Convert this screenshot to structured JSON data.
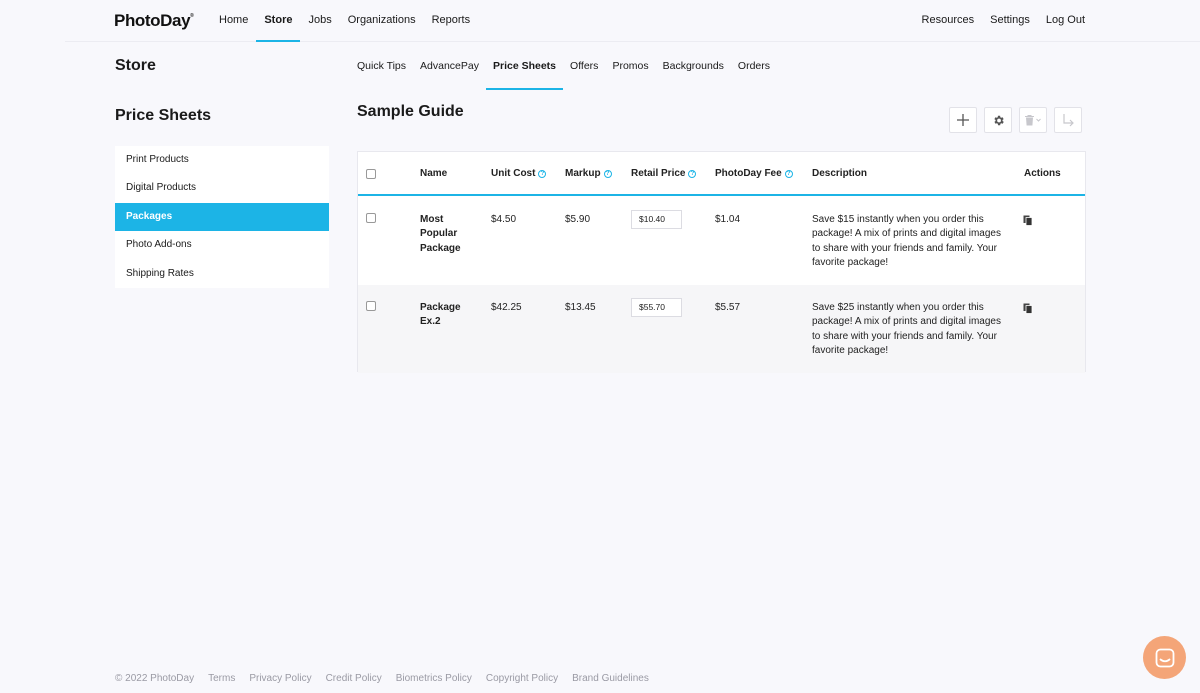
{
  "app": {
    "logo": "PhotoDay",
    "logo_mark": "®"
  },
  "topnav": {
    "left": [
      "Home",
      "Store",
      "Jobs",
      "Organizations",
      "Reports"
    ],
    "right": [
      "Resources",
      "Settings",
      "Log Out"
    ]
  },
  "store": {
    "title": "Store",
    "tabs": [
      "Quick Tips",
      "AdvancePay",
      "Price Sheets",
      "Offers",
      "Promos",
      "Backgrounds",
      "Orders"
    ]
  },
  "sidebar": {
    "title": "Price Sheets",
    "items": [
      "Print Products",
      "Digital Products",
      "Packages",
      "Photo Add-ons",
      "Shipping Rates"
    ]
  },
  "main": {
    "title": "Sample Guide",
    "help_glyph": "?",
    "columns": {
      "name": "Name",
      "unit_cost": "Unit Cost",
      "markup": "Markup",
      "retail_price": "Retail Price",
      "photoday_fee": "PhotoDay Fee",
      "description": "Description",
      "actions": "Actions"
    },
    "rows": [
      {
        "name": "Most Popular Package",
        "unit_cost": "$4.50",
        "markup": "$5.90",
        "retail_price": "$10.40",
        "photoday_fee": "$1.04",
        "description": "Save $15 instantly when you order this package! A mix of prints and digital images to share with your friends and family. Your favorite package!"
      },
      {
        "name": "Package Ex.2",
        "unit_cost": "$42.25",
        "markup": "$13.45",
        "retail_price": "$55.70",
        "photoday_fee": "$5.57",
        "description": "Save $25 instantly when you order this package! A mix of prints and digital images to share with your friends and family. Your favorite package!"
      }
    ]
  },
  "footer": {
    "copyright": "© 2022 PhotoDay",
    "links": [
      "Terms",
      "Privacy Policy",
      "Credit Policy",
      "Biometrics Policy",
      "Copyright Policy",
      "Brand Guidelines"
    ]
  },
  "colors": {
    "accent": "#1cb4e6",
    "chat": "#f4a578"
  }
}
